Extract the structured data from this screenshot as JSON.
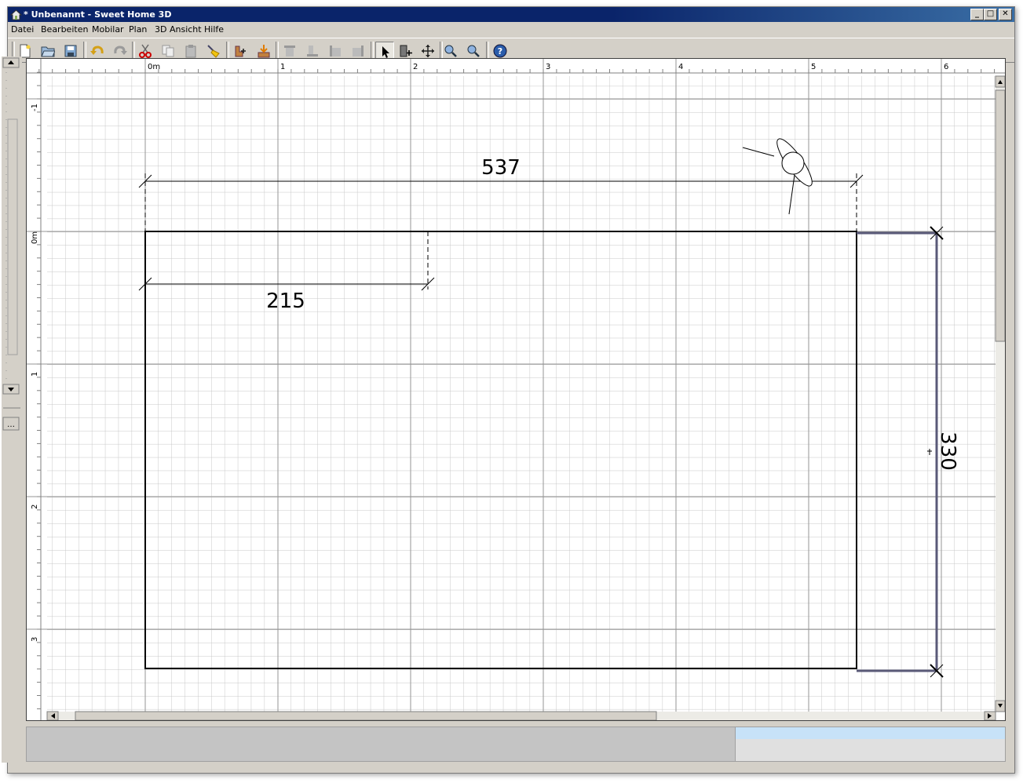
{
  "window": {
    "title": "* Unbenannt - Sweet Home 3D",
    "controls": {
      "minimize": "_",
      "maximize": "□",
      "close": "✕"
    }
  },
  "menubar": {
    "items": [
      "Datei",
      "Bearbeiten",
      "Mobilar",
      "Plan",
      "3D Ansicht",
      "Hilfe"
    ]
  },
  "toolbar": {
    "buttons": [
      "new-file-icon",
      "open-folder-icon",
      "save-icon",
      "undo-icon",
      "redo-icon",
      "cut-icon",
      "copy-icon",
      "paste-icon",
      "delete-broom-icon",
      "add-furniture-icon",
      "import-furniture-icon",
      "align-top-icon",
      "align-bottom-icon",
      "align-left-icon",
      "align-right-icon",
      "select-arrow-icon",
      "create-walls-icon",
      "pan-icon",
      "zoom-in-icon",
      "zoom-out-icon",
      "help-icon"
    ],
    "pressed": "select-arrow-icon"
  },
  "plan": {
    "ruler_x_labels": [
      "0m",
      "1",
      "2",
      "3",
      "4",
      "5",
      "6"
    ],
    "ruler_y_labels": [
      "-1",
      "0m",
      "1",
      "2",
      "3"
    ],
    "dimensions": {
      "top_width": "537",
      "inner_width": "215",
      "right_height": "330"
    },
    "colors": {
      "grid": "#c8c8c8",
      "grid_major": "#969696",
      "wall": "#000000",
      "selection": "#5a5a78"
    }
  }
}
